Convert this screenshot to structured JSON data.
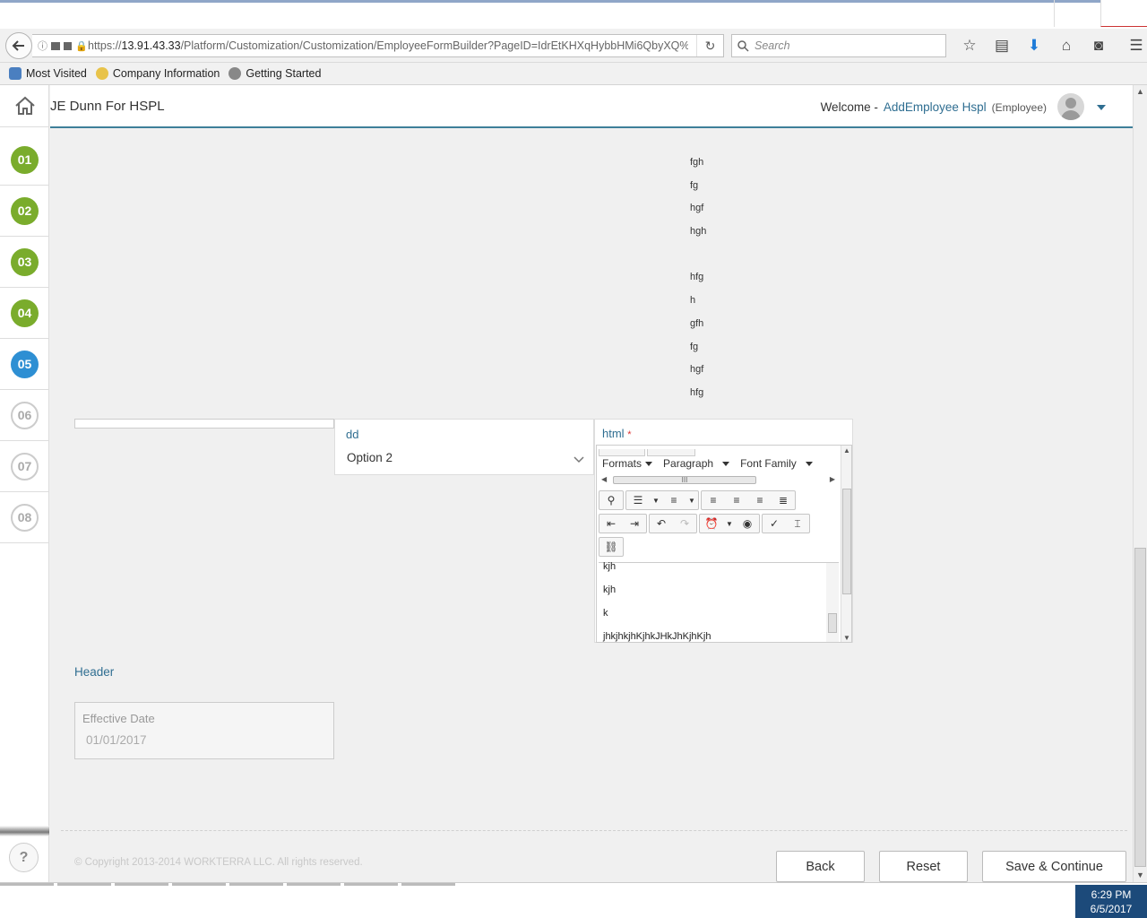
{
  "browser": {
    "url_prefix": "https://",
    "url_host": "13.91.43.33",
    "url_path": "/Platform/Customization/Customization/EmployeeFormBuilder?PageID=IdrEtKHXqHybbHMi6QbyXQ%",
    "search_placeholder": "Search",
    "bookmarks": [
      "Most Visited",
      "Company Information",
      "Getting Started"
    ]
  },
  "header": {
    "company": "JE Dunn For HSPL",
    "welcome": "Welcome -",
    "user_name": "AddEmployee Hspl",
    "user_role": "(Employee)"
  },
  "steps": [
    {
      "label": "01",
      "state": "done"
    },
    {
      "label": "02",
      "state": "done"
    },
    {
      "label": "03",
      "state": "done"
    },
    {
      "label": "04",
      "state": "done"
    },
    {
      "label": "05",
      "state": "active"
    },
    {
      "label": "06",
      "state": "todo"
    },
    {
      "label": "07",
      "state": "todo"
    },
    {
      "label": "08",
      "state": "todo"
    }
  ],
  "html_preview_lines": [
    "fgh",
    "fg",
    "hgf",
    "hgh",
    "",
    "hfg",
    "h",
    "gfh",
    "fg",
    "hgf",
    "hfg"
  ],
  "dd_field": {
    "label": "dd",
    "value": "Option 2"
  },
  "html_field": {
    "label": "html",
    "required_mark": "*",
    "toolbar": {
      "formats": "Formats",
      "paragraph": "Paragraph",
      "font_family": "Font Family",
      "scroll_grip": "III"
    },
    "content_lines": [
      "kjh",
      "kjh",
      "k",
      "jhkjhkjhKjhkJHkJhKjhKjh"
    ]
  },
  "header_label": "Header",
  "effective_date": {
    "label": "Effective Date",
    "value": "01/01/2017"
  },
  "footer": {
    "copyright": "© Copyright 2013-2014 WORKTERRA LLC. All rights reserved.",
    "back": "Back",
    "reset": "Reset",
    "save": "Save & Continue"
  },
  "taskbar": {
    "time": "6:29 PM",
    "date": "6/5/2017"
  },
  "colors": {
    "accent": "#2f6e91",
    "step_done": "#7aac2c",
    "step_active": "#2e8fd3",
    "header_rule": "#3e7f99"
  }
}
